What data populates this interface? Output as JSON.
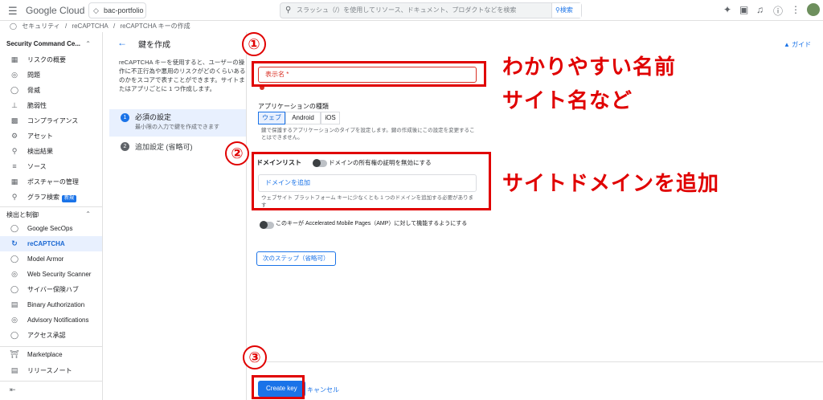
{
  "topbar": {
    "menu_icon": "menu-icon",
    "logo": "Google Cloud",
    "project": "bac-portfolio",
    "search_placeholder": "スラッシュ（/）を使用してリソース、ドキュメント、プロダクトなどを検索",
    "search_button": "検索"
  },
  "breadcrumb": [
    "セキュリティ",
    "/",
    "reCAPTCHA",
    "/",
    "reCAPTCHA キーの作成"
  ],
  "sidebar": {
    "section1": "Security Command Ce...",
    "items1": [
      {
        "label": "リスクの概要",
        "icon": "dashboard-icon"
      },
      {
        "label": "問題",
        "icon": "issue-icon"
      },
      {
        "label": "脅威",
        "icon": "shield-icon"
      },
      {
        "label": "脆弱性",
        "icon": "vulnerability-icon"
      },
      {
        "label": "コンプライアンス",
        "icon": "chart-icon"
      },
      {
        "label": "アセット",
        "icon": "asset-icon"
      },
      {
        "label": "検出結果",
        "icon": "findings-icon"
      },
      {
        "label": "ソース",
        "icon": "source-icon"
      },
      {
        "label": "ポスチャーの管理",
        "icon": "posture-icon"
      },
      {
        "label": "グラフ検索",
        "icon": "graph-icon",
        "badge": "新規"
      }
    ],
    "section2": "検出と制御",
    "items2": [
      {
        "label": "Google SecOps",
        "icon": "secops-icon"
      },
      {
        "label": "reCAPTCHA",
        "icon": "recaptcha-icon",
        "active": true
      },
      {
        "label": "Model Armor",
        "icon": "armor-icon"
      },
      {
        "label": "Web Security Scanner",
        "icon": "scanner-icon"
      },
      {
        "label": "サイバー保険ハブ",
        "icon": "insurance-icon"
      },
      {
        "label": "Binary Authorization",
        "icon": "binary-icon"
      },
      {
        "label": "Advisory Notifications",
        "icon": "notification-icon"
      },
      {
        "label": "アクセス承認",
        "icon": "access-icon"
      }
    ],
    "marketplace": "Marketplace",
    "release_notes": "リリースノート"
  },
  "middle": {
    "title": "鍵を作成",
    "description": "reCAPTCHA キーを使用すると、ユーザーの操作に不正行為や悪用のリスクがどのくらいあるのかをスコアで表すことができます。サイトまたはアプリごとに 1 つ作成します。",
    "step1_num": "1",
    "step1_title": "必須の設定",
    "step1_sub": "最小限の入力で鍵を作成できます",
    "step2_num": "2",
    "step2_title": "追加設定 (省略可)"
  },
  "form": {
    "guide": "ガイド",
    "display_name_placeholder": "表示名 *",
    "app_type_label": "アプリケーションの種類",
    "app_types": [
      "ウェブ",
      "Android",
      "iOS"
    ],
    "app_type_help": "鍵で保護するアプリケーションのタイプを設定します。鍵の作成後にこの設定を変更することはできません。",
    "domain_list_label": "ドメインリスト",
    "domain_toggle_label": "ドメインの所有権の証明を無効にする",
    "domain_add_placeholder": "ドメインを追加",
    "domain_help": "ウェブサイト プラットフォーム キーに少なくとも 1 つのドメインを追加する必要があります",
    "amp_label": "このキーが Accelerated Mobile Pages（AMP）に対して機能するようにする",
    "next_step": "次のステップ（省略可）",
    "create_key": "Create key",
    "cancel": "キャンセル"
  },
  "annotations": {
    "num1": "①",
    "num2": "②",
    "num3": "③",
    "text1": "わかりやすい名前",
    "text2": "サイト名など",
    "text3": "サイトドメインを追加",
    "color": "#e00000"
  }
}
